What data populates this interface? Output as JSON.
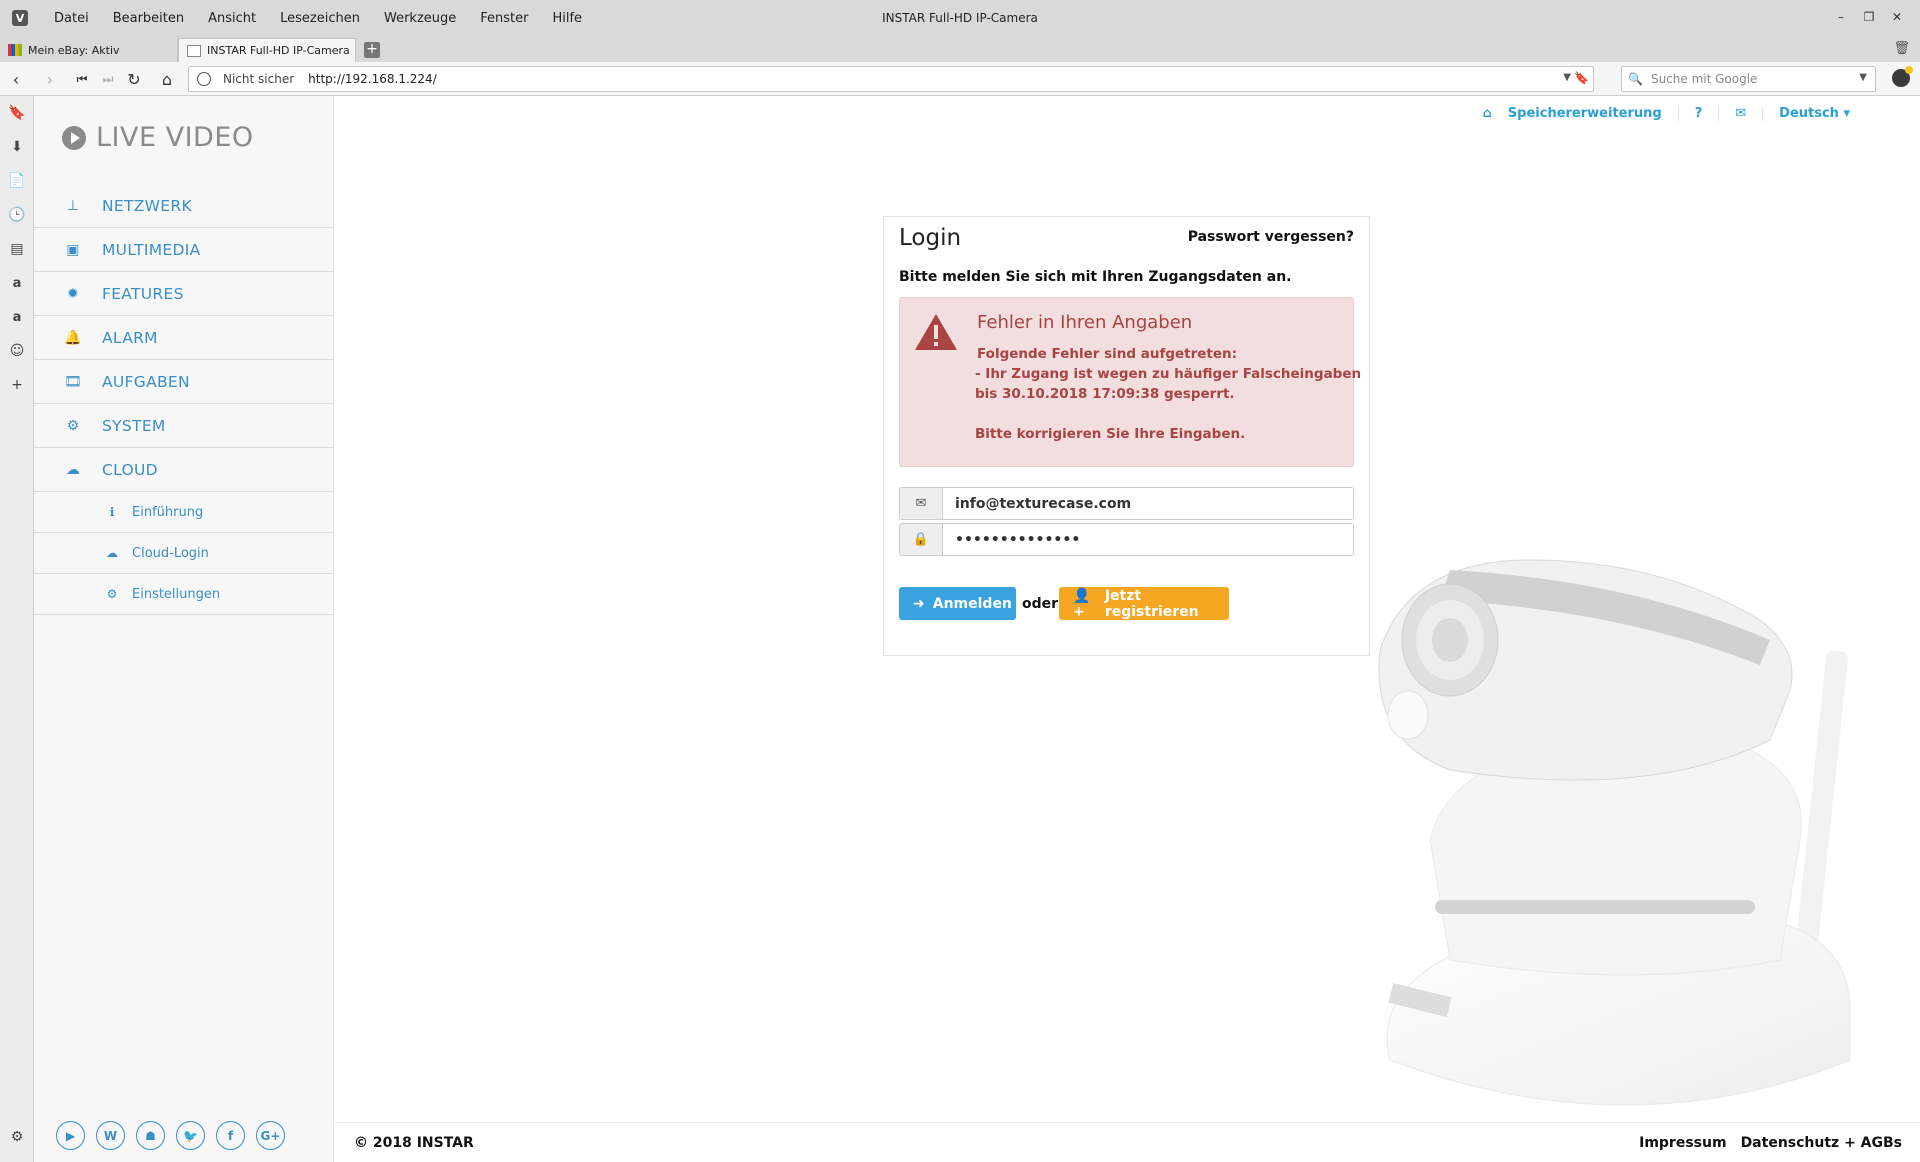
{
  "window": {
    "title": "INSTAR Full-HD IP-Camera",
    "menu": [
      "Datei",
      "Bearbeiten",
      "Ansicht",
      "Lesezeichen",
      "Werkzeuge",
      "Fenster",
      "Hilfe"
    ]
  },
  "tabs": [
    {
      "label": "Mein eBay: Aktiv"
    },
    {
      "label": "INSTAR Full-HD IP-Camera"
    }
  ],
  "addressbar": {
    "security": "Nicht sicher",
    "url": "http://192.168.1.224/",
    "search_placeholder": "Suche mit Google"
  },
  "sidebar": {
    "live": "LIVE VIDEO",
    "items": [
      {
        "label": "NETZWERK",
        "icon": "sitemap-icon"
      },
      {
        "label": "MULTIMEDIA",
        "icon": "image-icon"
      },
      {
        "label": "FEATURES",
        "icon": "cog-icon"
      },
      {
        "label": "ALARM",
        "icon": "bell-icon"
      },
      {
        "label": "AUFGABEN",
        "icon": "film-icon"
      },
      {
        "label": "SYSTEM",
        "icon": "gear-icon"
      },
      {
        "label": "CLOUD",
        "icon": "cloud-icon"
      }
    ],
    "subitems": [
      {
        "label": "Einführung",
        "icon": "info-icon"
      },
      {
        "label": "Cloud-Login",
        "icon": "cloud-icon"
      },
      {
        "label": "Einstellungen",
        "icon": "cogs-icon"
      }
    ]
  },
  "topnav": {
    "storage": "Speichererweiterung",
    "help": "?",
    "language": "Deutsch"
  },
  "login": {
    "title": "Login",
    "forgot": "Passwort vergessen?",
    "lead": "Bitte melden Sie sich mit Ihren Zugangsdaten an.",
    "alert": {
      "heading": "Fehler in Ihren Angaben",
      "line1": "Folgende Fehler sind aufgetreten:",
      "line2": "- Ihr Zugang ist wegen zu häufiger Falscheingaben",
      "line3": "bis 30.10.2018 17:09:38 gesperrt.",
      "line4": "Bitte korrigieren Sie Ihre Eingaben."
    },
    "email_value": "info@texturecase.com",
    "password_value": "••••••••••••••",
    "login_button": "Anmelden",
    "or": "oder",
    "register_button": "Jetzt registrieren"
  },
  "footer": {
    "copyright": "© 2018 INSTAR",
    "impressum": "Impressum",
    "privacy": "Datenschutz + AGBs"
  },
  "colors": {
    "accent": "#3a8fc9",
    "link": "#2a9fd6",
    "alert_bg": "#f2dede",
    "alert_text": "#a94442",
    "btn_blue": "#3aa3df",
    "btn_orange": "#f5a623"
  }
}
